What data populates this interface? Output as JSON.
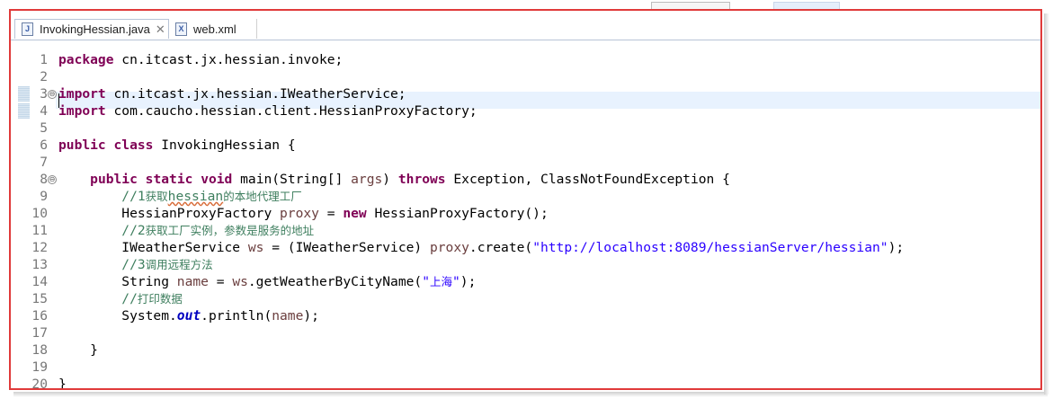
{
  "tabs": [
    {
      "label": "InvokingHessian.java",
      "icon": "J",
      "close": "✕"
    },
    {
      "label": "web.xml",
      "icon": "X"
    }
  ],
  "lines": [
    {
      "n": "1",
      "segs": [
        {
          "c": "kw",
          "t": "package"
        },
        {
          "c": "",
          "t": " cn.itcast.jx.hessian.invoke;"
        }
      ]
    },
    {
      "n": "2",
      "segs": []
    },
    {
      "n": "3",
      "fold": "⊖",
      "segs": [
        {
          "c": "kw",
          "t": "import"
        },
        {
          "c": "",
          "t": " cn.itcast.jx.hessian.IWeatherService;"
        }
      ]
    },
    {
      "n": "4",
      "segs": [
        {
          "c": "kw",
          "t": "import"
        },
        {
          "c": "",
          "t": " com.caucho.hessian.client.HessianProxyFactory;"
        }
      ]
    },
    {
      "n": "5",
      "segs": []
    },
    {
      "n": "6",
      "segs": [
        {
          "c": "kw",
          "t": "public"
        },
        {
          "c": "",
          "t": " "
        },
        {
          "c": "kw",
          "t": "class"
        },
        {
          "c": "",
          "t": " InvokingHessian {"
        }
      ]
    },
    {
      "n": "7",
      "segs": []
    },
    {
      "n": "8",
      "fold": "⊖",
      "segs": [
        {
          "c": "",
          "t": "    "
        },
        {
          "c": "kw",
          "t": "public"
        },
        {
          "c": "",
          "t": " "
        },
        {
          "c": "kw",
          "t": "static"
        },
        {
          "c": "",
          "t": " "
        },
        {
          "c": "kw",
          "t": "void"
        },
        {
          "c": "",
          "t": " main(String[] "
        },
        {
          "c": "var",
          "t": "args"
        },
        {
          "c": "",
          "t": ") "
        },
        {
          "c": "kw",
          "t": "throws"
        },
        {
          "c": "",
          "t": " Exception, ClassNotFoundException {"
        }
      ]
    },
    {
      "n": "9",
      "segs": [
        {
          "c": "",
          "t": "        "
        },
        {
          "c": "cm",
          "t": "//1"
        },
        {
          "c": "cm cjk",
          "t": "获取"
        },
        {
          "c": "cm squig",
          "t": "hessian"
        },
        {
          "c": "cm cjk",
          "t": "的本地代理工厂"
        }
      ]
    },
    {
      "n": "10",
      "segs": [
        {
          "c": "",
          "t": "        HessianProxyFactory "
        },
        {
          "c": "var",
          "t": "proxy"
        },
        {
          "c": "",
          "t": " = "
        },
        {
          "c": "kw",
          "t": "new"
        },
        {
          "c": "",
          "t": " HessianProxyFactory();"
        }
      ]
    },
    {
      "n": "11",
      "segs": [
        {
          "c": "",
          "t": "        "
        },
        {
          "c": "cm",
          "t": "//2"
        },
        {
          "c": "cm cjk",
          "t": "获取工厂实例，参数是服务的地址"
        }
      ]
    },
    {
      "n": "12",
      "segs": [
        {
          "c": "",
          "t": "        IWeatherService "
        },
        {
          "c": "var",
          "t": "ws"
        },
        {
          "c": "",
          "t": " = (IWeatherService) "
        },
        {
          "c": "var",
          "t": "proxy"
        },
        {
          "c": "",
          "t": ".create("
        },
        {
          "c": "str",
          "t": "\"http://localhost:8089/hessianServer/hessian\""
        },
        {
          "c": "",
          "t": ");"
        }
      ]
    },
    {
      "n": "13",
      "segs": [
        {
          "c": "",
          "t": "        "
        },
        {
          "c": "cm",
          "t": "//3"
        },
        {
          "c": "cm cjk",
          "t": "调用远程方法"
        }
      ]
    },
    {
      "n": "14",
      "segs": [
        {
          "c": "",
          "t": "        String "
        },
        {
          "c": "var",
          "t": "name"
        },
        {
          "c": "",
          "t": " = "
        },
        {
          "c": "var",
          "t": "ws"
        },
        {
          "c": "",
          "t": ".getWeatherByCityName("
        },
        {
          "c": "str",
          "t": "\""
        },
        {
          "c": "str cjk",
          "t": "上海"
        },
        {
          "c": "str",
          "t": "\""
        },
        {
          "c": "",
          "t": ");"
        }
      ]
    },
    {
      "n": "15",
      "segs": [
        {
          "c": "",
          "t": "        "
        },
        {
          "c": "cm",
          "t": "//"
        },
        {
          "c": "cm cjk",
          "t": "打印数据"
        }
      ]
    },
    {
      "n": "16",
      "segs": [
        {
          "c": "",
          "t": "        System."
        },
        {
          "c": "stat",
          "t": "out"
        },
        {
          "c": "",
          "t": ".println("
        },
        {
          "c": "var",
          "t": "name"
        },
        {
          "c": "",
          "t": ");"
        }
      ]
    },
    {
      "n": "17",
      "segs": []
    },
    {
      "n": "18",
      "segs": [
        {
          "c": "",
          "t": "    }"
        }
      ]
    },
    {
      "n": "19",
      "segs": []
    },
    {
      "n": "20",
      "segs": [
        {
          "c": "",
          "t": "}"
        }
      ]
    }
  ],
  "colors": {
    "frame": "#e03a3a",
    "keyword": "#7f0055",
    "string": "#2a00ff",
    "comment": "#3f7f5f",
    "variable": "#6a3e3e",
    "current_line": "#e8f2fe"
  }
}
